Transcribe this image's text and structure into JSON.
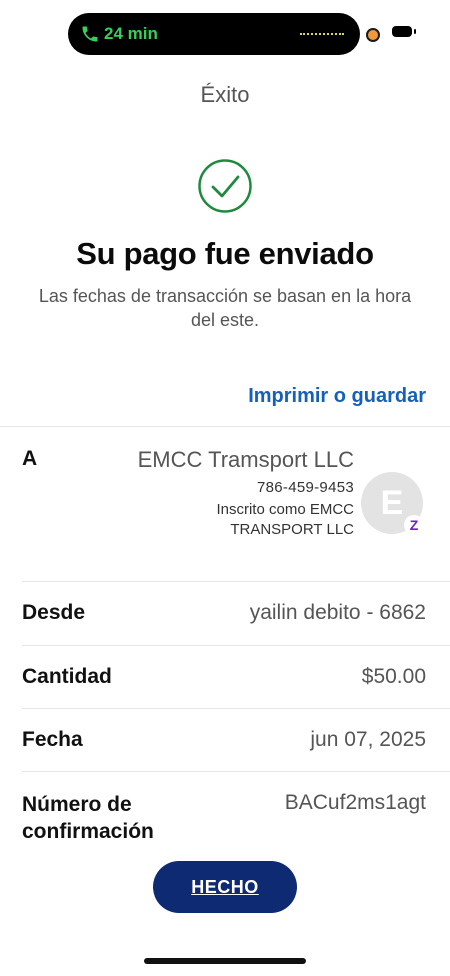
{
  "status_bar": {
    "call_duration": "24 min",
    "icons": [
      "phone-icon",
      "audio-wave-icon",
      "camera-indicator-icon",
      "battery-icon"
    ]
  },
  "page": {
    "title": "Éxito",
    "headline": "Su pago fue enviado",
    "subtext": "Las fechas de transacción se basan en la hora del este.",
    "print_link": "Imprimir o guardar"
  },
  "recipient": {
    "label": "A",
    "name": "EMCC Tramsport LLC",
    "phone": "786-459-9453",
    "enrolled_as": "Inscrito como EMCC TRANSPORT LLC",
    "avatar_letter": "E",
    "badge_glyph": "Z"
  },
  "details": [
    {
      "label": "Desde",
      "value": "yailin debito - 6862"
    },
    {
      "label": "Cantidad",
      "value": "$50.00"
    },
    {
      "label": "Fecha",
      "value": "jun 07, 2025"
    },
    {
      "label": "Número de confirmación",
      "value": "BACuf2ms1agt"
    }
  ],
  "actions": {
    "done_label": "HECHO"
  },
  "colors": {
    "accent_link": "#1560b8",
    "button_bg": "#0d2a72",
    "success_green": "#1e8a3e",
    "zelle_purple": "#6d1ed4",
    "call_green": "#35d05a"
  }
}
